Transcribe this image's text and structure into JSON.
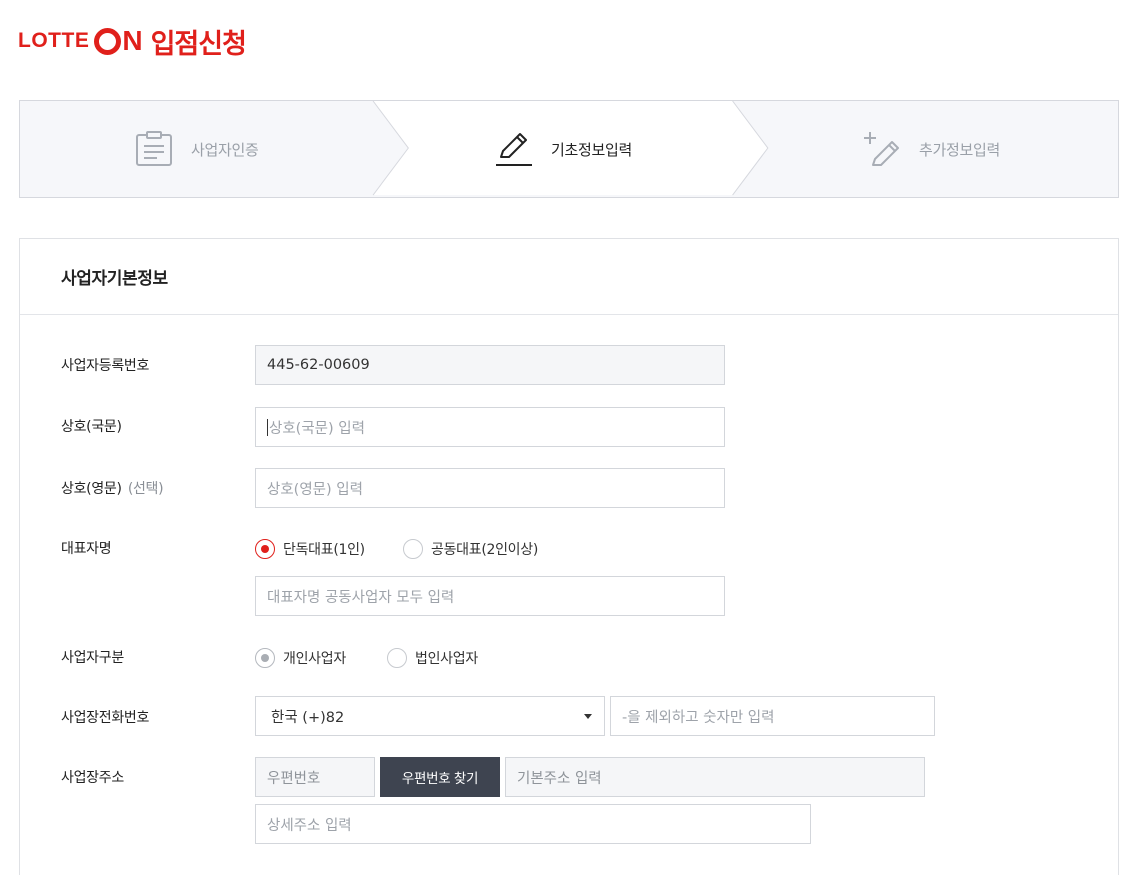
{
  "header": {
    "brand_lotte": "LOTTE",
    "brand_on_n": "N",
    "title": "입점신청"
  },
  "stepper": {
    "steps": [
      {
        "label": "사업자인증",
        "icon": "clipboard-icon",
        "state": "done"
      },
      {
        "label": "기초정보입력",
        "icon": "pencil-icon",
        "state": "active"
      },
      {
        "label": "추가정보입력",
        "icon": "add-pencil-icon",
        "state": "upcoming"
      }
    ]
  },
  "form": {
    "title": "사업자기본정보",
    "business_number": {
      "label": "사업자등록번호",
      "value": "445-62-00609"
    },
    "company_name_kr": {
      "label": "상호(국문)",
      "placeholder": "상호(국문) 입력"
    },
    "company_name_en": {
      "label": "상호(영문)",
      "optional": "(선택)",
      "placeholder": "상호(영문) 입력"
    },
    "representative": {
      "label": "대표자명",
      "options": [
        {
          "label": "단독대표(1인)",
          "selected": true
        },
        {
          "label": "공동대표(2인이상)",
          "selected": false
        }
      ],
      "placeholder": "대표자명 공동사업자 모두 입력"
    },
    "business_type": {
      "label": "사업자구분",
      "options": [
        {
          "label": "개인사업자",
          "selected": true
        },
        {
          "label": "법인사업자",
          "selected": false
        }
      ]
    },
    "phone": {
      "label": "사업장전화번호",
      "country_value": "한국 (+)82",
      "placeholder": "-을 제외하고 숫자만 입력"
    },
    "address": {
      "label": "사업장주소",
      "zip_placeholder": "우편번호",
      "zip_button": "우편번호 찾기",
      "base_placeholder": "기본주소 입력",
      "detail_placeholder": "상세주소 입력"
    }
  },
  "colors": {
    "brand": "#e0201b",
    "dark_button": "#3e4450",
    "readonly_bg": "#f5f6f8"
  }
}
